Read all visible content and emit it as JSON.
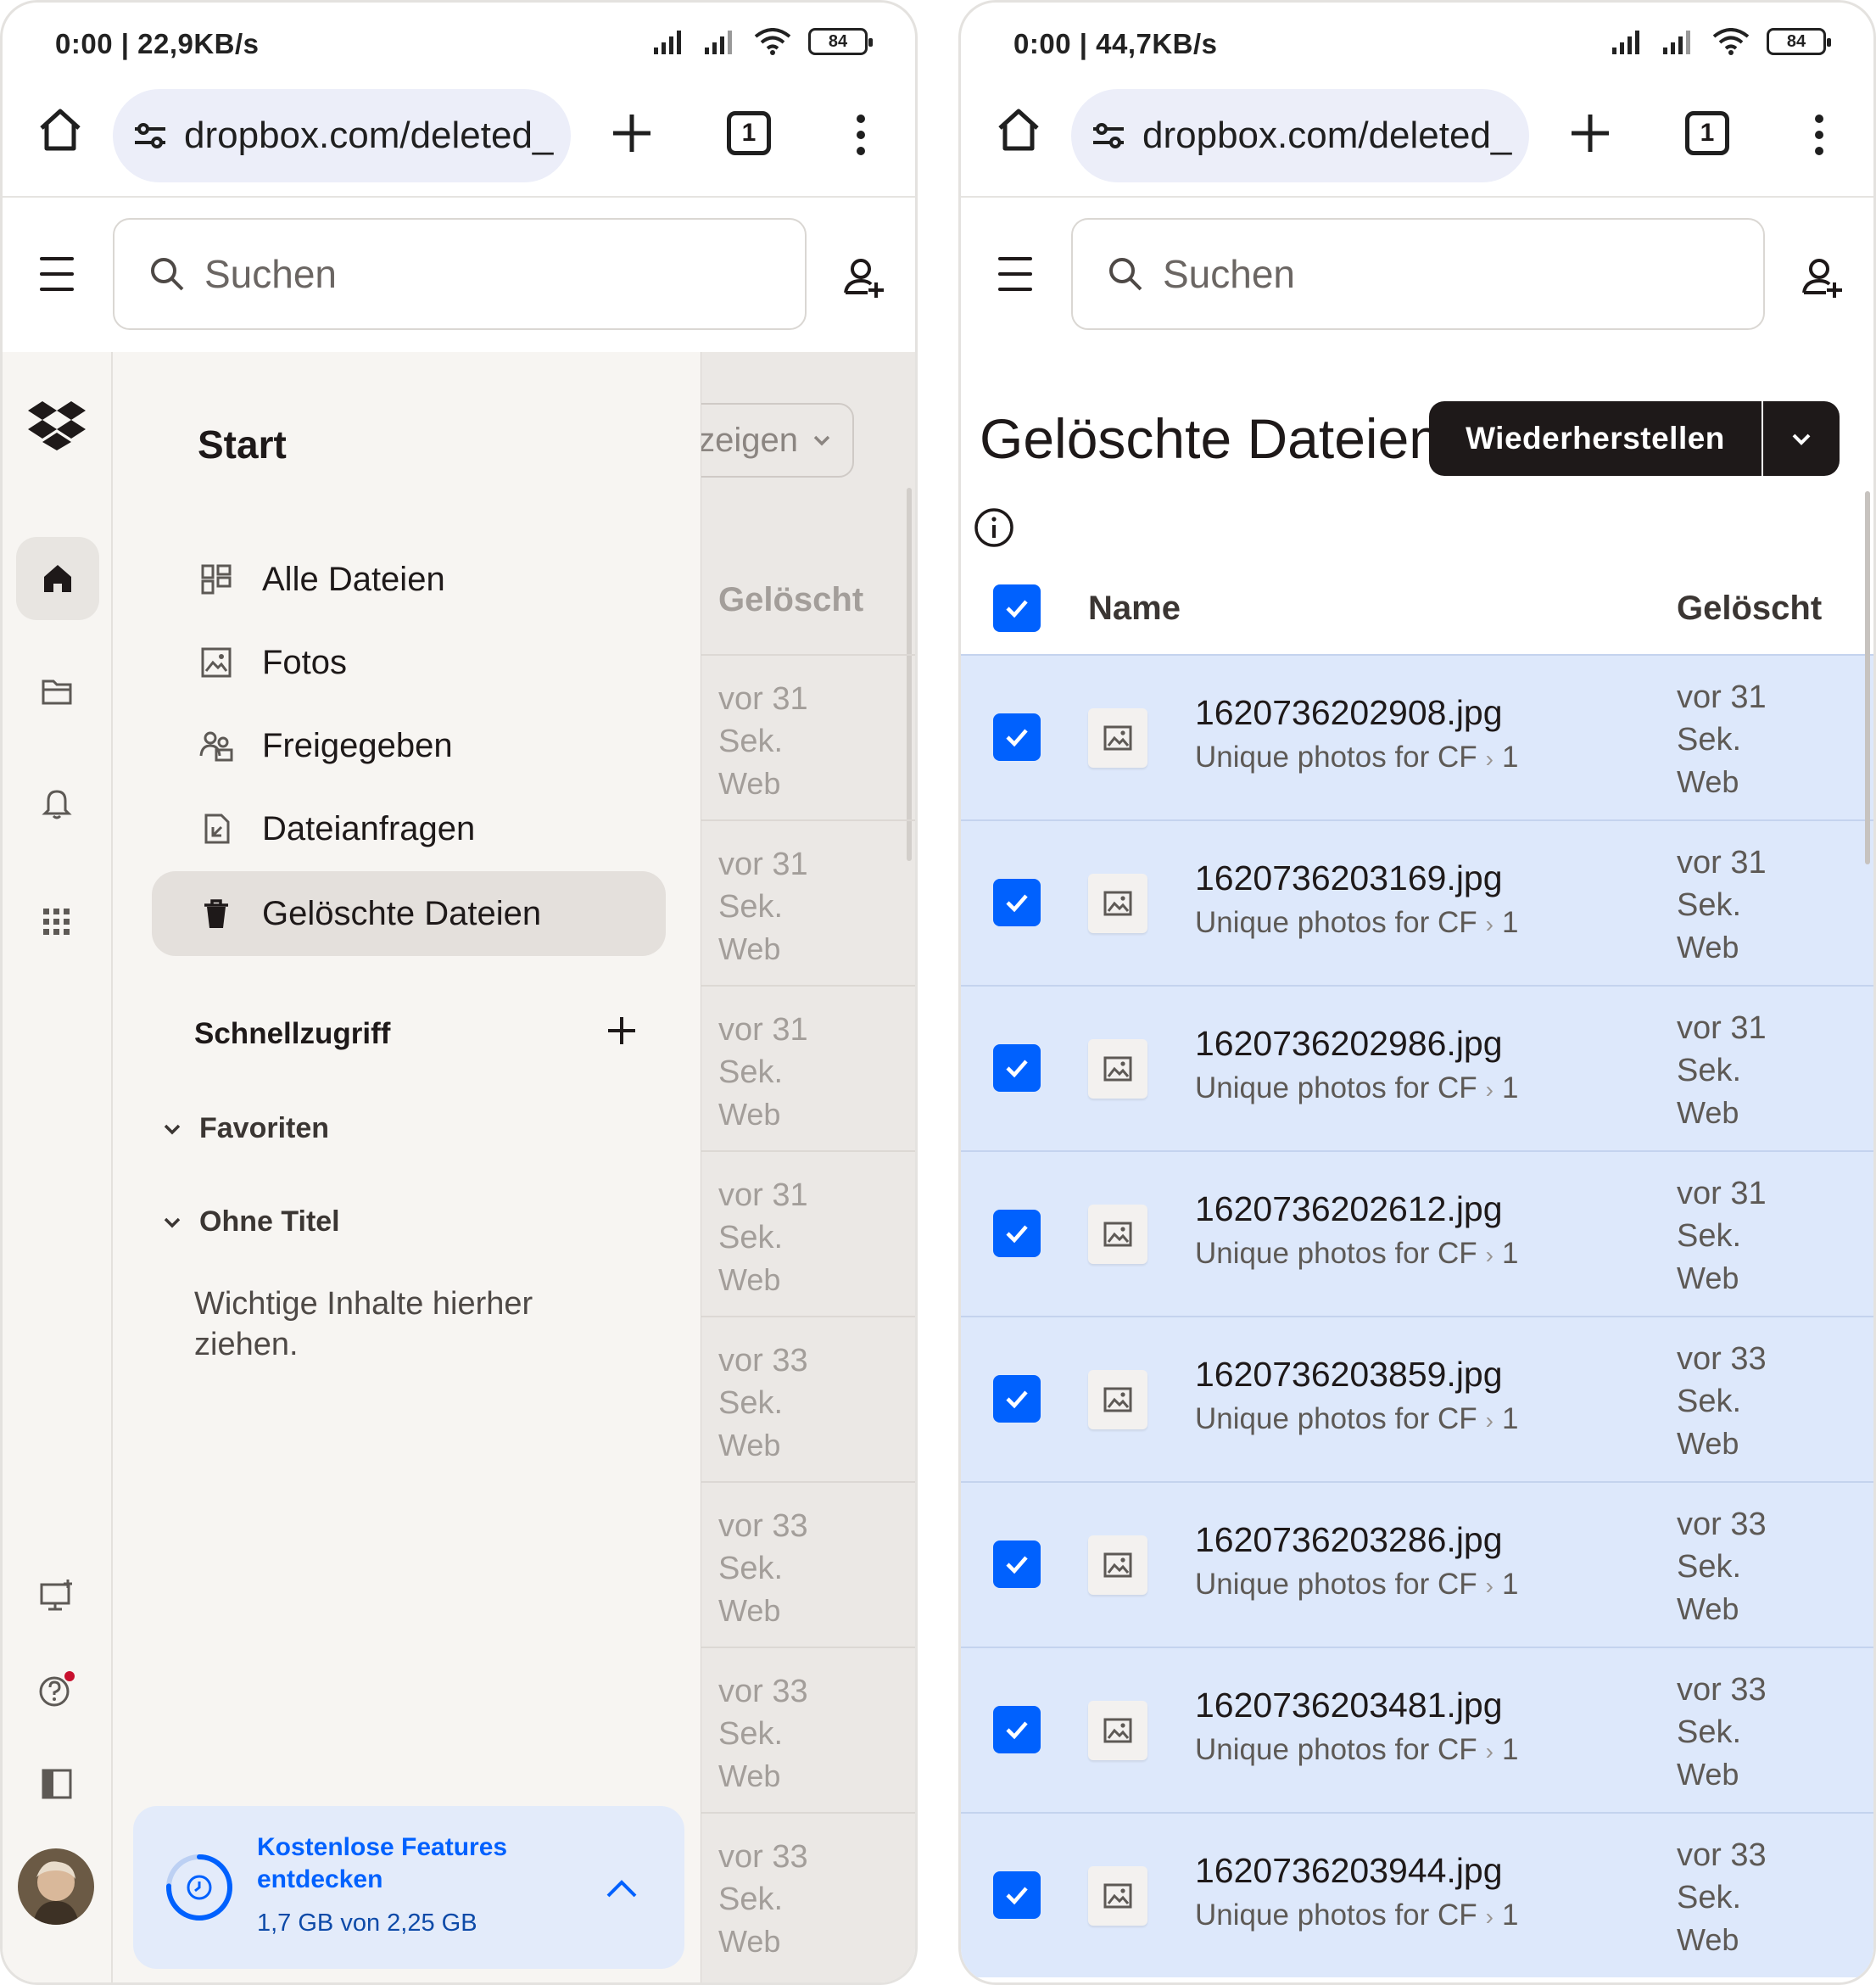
{
  "left": {
    "status": {
      "time_speed": "0:00 | 22,9KB/s",
      "battery": "84"
    },
    "browser": {
      "url": "dropbox.com/deleted_",
      "tab_count": "1"
    },
    "search": {
      "placeholder": "Suchen"
    },
    "drawer": {
      "title": "Start",
      "nav": [
        {
          "label": "Alle Dateien",
          "icon": "all-files-icon"
        },
        {
          "label": "Fotos",
          "icon": "photos-icon"
        },
        {
          "label": "Freigegeben",
          "icon": "shared-icon"
        },
        {
          "label": "Dateianfragen",
          "icon": "file-request-icon"
        },
        {
          "label": "Gelöschte Dateien",
          "icon": "trash-icon",
          "active": true
        }
      ],
      "quick_access": "Schnellzugriff",
      "groups": [
        "Favoriten",
        "Ohne Titel"
      ],
      "drop_hint": "Wichtige Inhalte hierher ziehen.",
      "promo": {
        "title": "Kostenlose Features entdecken",
        "usage": "1,7 GB von 2,25 GB",
        "usage_fraction": 0.756
      }
    },
    "peek": {
      "dropdown": "nzeigen",
      "header": "Gelöscht",
      "rows": [
        {
          "line1": "vor 31",
          "line2": "Sek.",
          "src": "Web"
        },
        {
          "line1": "vor 31",
          "line2": "Sek.",
          "src": "Web"
        },
        {
          "line1": "vor 31",
          "line2": "Sek.",
          "src": "Web"
        },
        {
          "line1": "vor 31",
          "line2": "Sek.",
          "src": "Web"
        },
        {
          "line1": "vor 33",
          "line2": "Sek.",
          "src": "Web"
        },
        {
          "line1": "vor 33",
          "line2": "Sek.",
          "src": "Web"
        },
        {
          "line1": "vor 33",
          "line2": "Sek.",
          "src": "Web"
        },
        {
          "line1": "vor 33",
          "line2": "Sek.",
          "src": "Web"
        }
      ]
    }
  },
  "right": {
    "status": {
      "time_speed": "0:00 | 44,7KB/s",
      "battery": "84"
    },
    "browser": {
      "url": "dropbox.com/deleted_",
      "tab_count": "1"
    },
    "search": {
      "placeholder": "Suchen"
    },
    "page_title": "Gelöschte Dateien",
    "restore_label": "Wiederherstellen",
    "table": {
      "col_name": "Name",
      "col_deleted": "Gelöscht",
      "rows": [
        {
          "name": "1620736202908.jpg",
          "folder": "Unique photos for CF",
          "sub": "1",
          "del1": "vor 31",
          "del2": "Sek.",
          "src": "Web"
        },
        {
          "name": "1620736203169.jpg",
          "folder": "Unique photos for CF",
          "sub": "1",
          "del1": "vor 31",
          "del2": "Sek.",
          "src": "Web"
        },
        {
          "name": "1620736202986.jpg",
          "folder": "Unique photos for CF",
          "sub": "1",
          "del1": "vor 31",
          "del2": "Sek.",
          "src": "Web"
        },
        {
          "name": "1620736202612.jpg",
          "folder": "Unique photos for CF",
          "sub": "1",
          "del1": "vor 31",
          "del2": "Sek.",
          "src": "Web"
        },
        {
          "name": "1620736203859.jpg",
          "folder": "Unique photos for CF",
          "sub": "1",
          "del1": "vor 33",
          "del2": "Sek.",
          "src": "Web"
        },
        {
          "name": "1620736203286.jpg",
          "folder": "Unique photos for CF",
          "sub": "1",
          "del1": "vor 33",
          "del2": "Sek.",
          "src": "Web"
        },
        {
          "name": "1620736203481.jpg",
          "folder": "Unique photos for CF",
          "sub": "1",
          "del1": "vor 33",
          "del2": "Sek.",
          "src": "Web"
        },
        {
          "name": "1620736203944.jpg",
          "folder": "Unique photos for CF",
          "sub": "1",
          "del1": "vor 33",
          "del2": "Sek.",
          "src": "Web"
        }
      ]
    }
  },
  "colors": {
    "accent": "#0061fe",
    "text": "#1e1919",
    "selected_row": "#dde8fb",
    "drawer_bg": "#f7f5f2"
  }
}
